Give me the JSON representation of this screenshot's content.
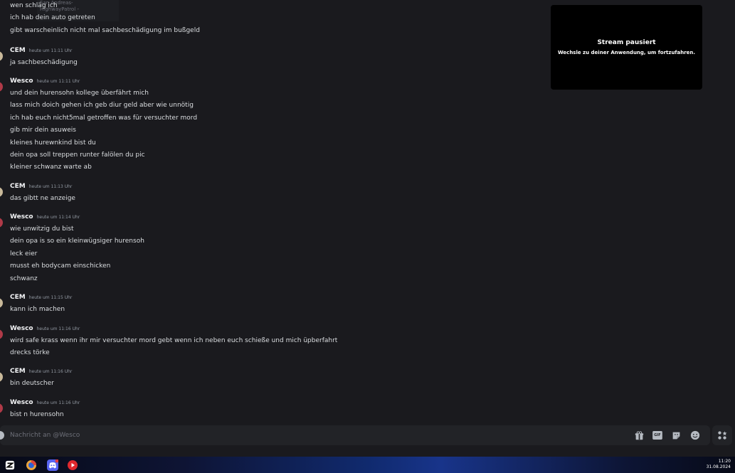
{
  "ghost_overlay": {
    "lines": [
      "San Andreas-",
      "HighwayPatrol -"
    ]
  },
  "messages": {
    "intro": {
      "lines": [
        "wen schläg ich",
        "ich hab dein auto getreten",
        "gibt warscheinlich nicht mal sachbeschädigung im bußgeld"
      ]
    },
    "m1": {
      "author": "CEM",
      "time": "heute um 11:11 Uhr",
      "lines": [
        "ja sachbeschädigung"
      ]
    },
    "m2": {
      "author": "Wesco",
      "time": "heute um 11:11 Uhr",
      "lines": [
        "und dein hurensohn kollege überfährt mich",
        "lass mich doich gehen ich geb diur geld aber wie unnötig",
        "ich hab euch nicht5mal getroffen was für versuchter mord",
        "gib mir dein asuweis",
        "kleines hurewnkind bist du",
        "dein opa soll treppen runter falölen du pic",
        "kleiner schwanz warte ab"
      ]
    },
    "m3": {
      "author": "CEM",
      "time": "heute um 11:13 Uhr",
      "lines": [
        "das gibtt ne anzeige"
      ]
    },
    "m4": {
      "author": "Wesco",
      "time": "heute um 11:14 Uhr",
      "lines": [
        "wie unwitzig du bist",
        "dein opa is so ein kleinwügsiger hurensoh",
        "leck eier",
        "musst eh bodycam einschicken",
        "schwanz"
      ]
    },
    "m5": {
      "author": "CEM",
      "time": "heute um 11:15 Uhr",
      "lines": [
        "kann ich machen"
      ]
    },
    "m6": {
      "author": "Wesco",
      "time": "heute um 11:16 Uhr",
      "lines": [
        "wird safe krass wenn ihr mir versuchter mord gebt wenn ich neben euch schieße und mich üpberfahrt",
        "drecks törke"
      ]
    },
    "m7": {
      "author": "CEM",
      "time": "heute um 11:16 Uhr",
      "lines": [
        "bin deutscher"
      ]
    },
    "m8": {
      "author": "Wesco",
      "time": "heute um 11:16 Uhr",
      "lines": [
        "bist n hurensohn"
      ]
    }
  },
  "stream": {
    "title": "Stream pausiert",
    "subtitle": "Wechsle zu deiner Anwendung, um fortzufahren."
  },
  "composer": {
    "placeholder": "Nachricht an @Wesco",
    "gif_label": "GIF"
  },
  "clock": {
    "time": "11:20",
    "date": "31.08.2024"
  },
  "colors": {
    "background": "#1a1a1e",
    "input": "#222327",
    "accent": "#5865f2",
    "taskbar": "#102a6e"
  }
}
